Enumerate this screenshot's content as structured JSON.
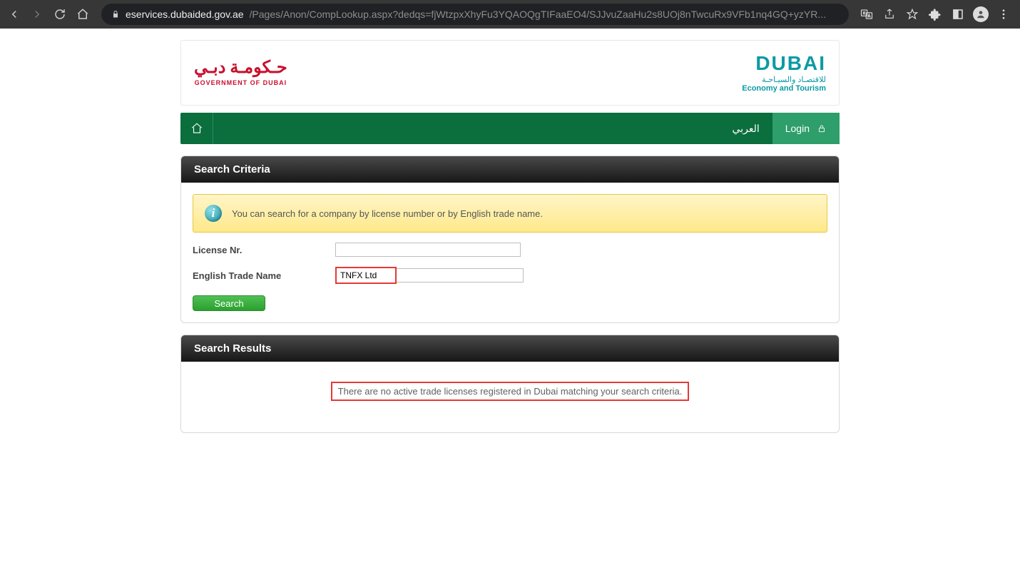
{
  "browser": {
    "url_host": "eservices.dubaided.gov.ae",
    "url_path": "/Pages/Anon/CompLookup.aspx?dedqs=fjWtzpxXhyFu3YQAOQgTIFaaEO4/SJJvuZaaHu2s8UOj8nTwcuRx9VFb1nq4GQ+yzYR..."
  },
  "logos": {
    "gov_arabic": "حـكومـة دبـي",
    "gov_sub": "GOVERNMENT OF DUBAI",
    "dubai_main": "DUBAI",
    "dubai_ar": "للاقتصـاد والسيـاحـة",
    "dubai_en": "Economy and Tourism"
  },
  "nav": {
    "lang": "العربي",
    "login": "Login"
  },
  "search_criteria": {
    "title": "Search Criteria",
    "info": "You can search for a company by license number or by English trade name.",
    "license_label": "License Nr.",
    "license_value": "",
    "trade_label": "English Trade Name",
    "trade_value": "TNFX Ltd",
    "search_button": "Search"
  },
  "search_results": {
    "title": "Search Results",
    "message": "There are no active trade licenses registered in Dubai matching your search criteria."
  }
}
